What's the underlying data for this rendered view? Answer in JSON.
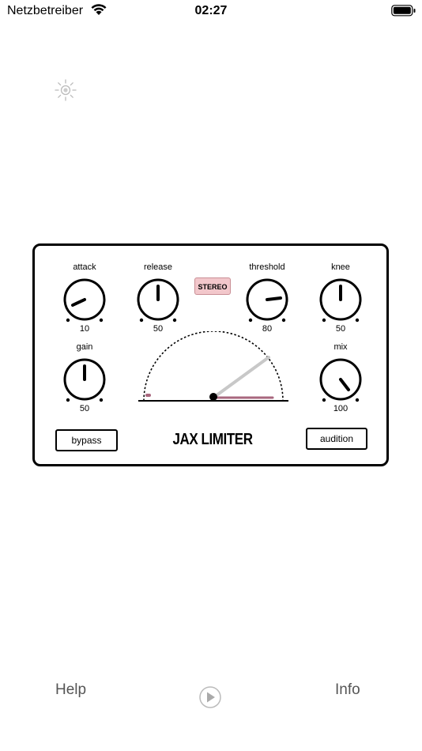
{
  "status_bar": {
    "carrier": "Netzbetreiber",
    "time": "02:27"
  },
  "plugin": {
    "title": "JAX LIMITER",
    "stereo_label": "STEREO",
    "bypass_label": "bypass",
    "audition_label": "audition",
    "knobs": {
      "attack": {
        "label": "attack",
        "value": "10"
      },
      "release": {
        "label": "release",
        "value": "50"
      },
      "threshold": {
        "label": "threshold",
        "value": "80"
      },
      "knee": {
        "label": "knee",
        "value": "50"
      },
      "gain": {
        "label": "gain",
        "value": "50"
      },
      "mix": {
        "label": "mix",
        "value": "100"
      }
    },
    "meter": {
      "accent_color": "#a8677e"
    }
  },
  "bottom_bar": {
    "help_label": "Help",
    "info_label": "Info"
  },
  "colors": {
    "stereo_bg": "#f2c7cb",
    "meter_accent": "#a8677e",
    "tab_text": "#555555"
  }
}
